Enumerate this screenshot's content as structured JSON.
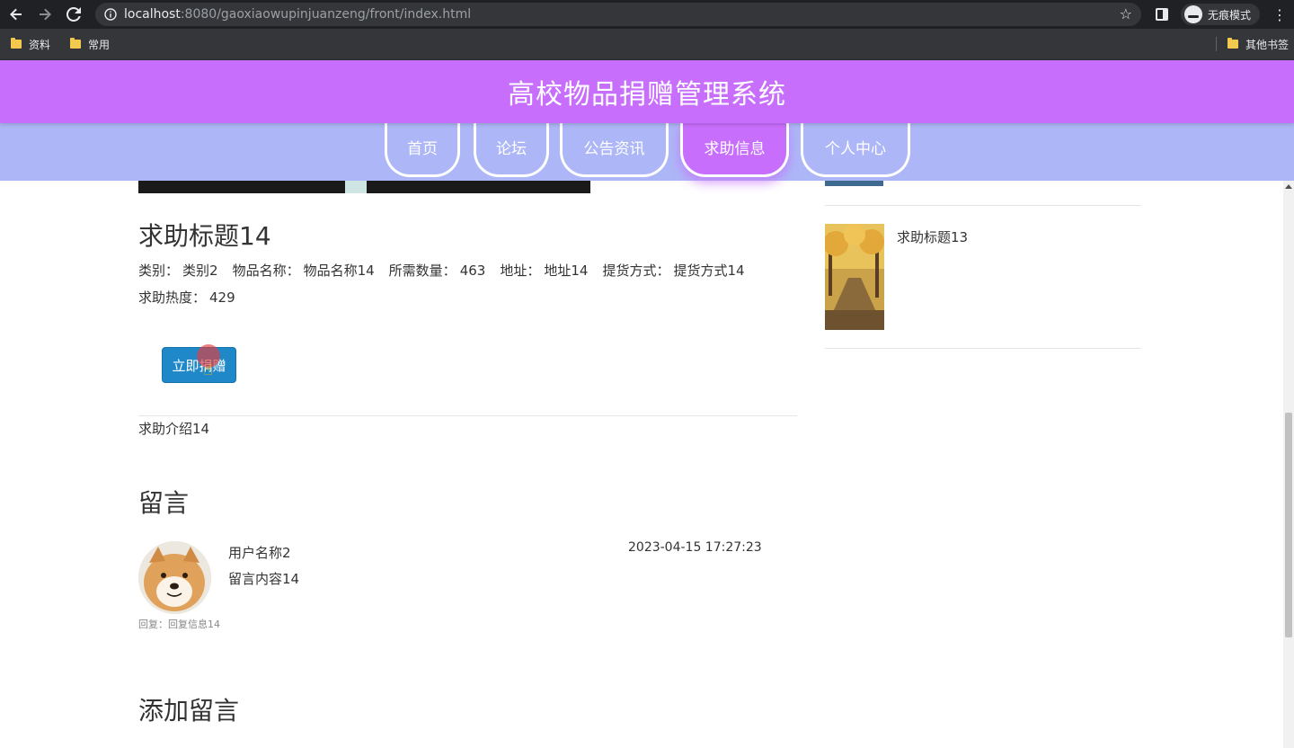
{
  "browser": {
    "url_host": "localhost",
    "url_rest": ":8080/gaoxiaowupinjuanzeng/front/index.html",
    "incognito_label": "无痕模式",
    "bookmarks": [
      "资料",
      "常用"
    ],
    "other_bookmarks": "其他书签"
  },
  "site": {
    "title": "高校物品捐赠管理系统",
    "nav": [
      "首页",
      "论坛",
      "公告资讯",
      "求助信息",
      "个人中心"
    ],
    "active_nav": "求助信息"
  },
  "detail": {
    "title": "求助标题14",
    "fields": {
      "category_label": "类别：",
      "category": "类别2",
      "item_label": "物品名称：",
      "item": "物品名称14",
      "quantity_label": "所需数量：",
      "quantity": "463",
      "address_label": "地址：",
      "address": "地址14",
      "pickup_label": "提货方式：",
      "pickup": "提货方式14",
      "heat_label": "求助热度：",
      "heat": "429"
    },
    "donate_button": "立即捐赠",
    "intro": "求助介绍14"
  },
  "comments": {
    "section_title": "留言",
    "items": [
      {
        "user": "用户名称2",
        "content": "留言内容14",
        "time": "2023-04-15 17:27:23",
        "reply": "回复：回复信息14"
      }
    ],
    "add_title": "添加留言"
  },
  "sidebar": {
    "items": [
      {
        "title": "求助标题13"
      }
    ]
  },
  "colors": {
    "header": "#c86efc",
    "nav_bar": "#adb7f7",
    "button": "#1e88c8"
  }
}
